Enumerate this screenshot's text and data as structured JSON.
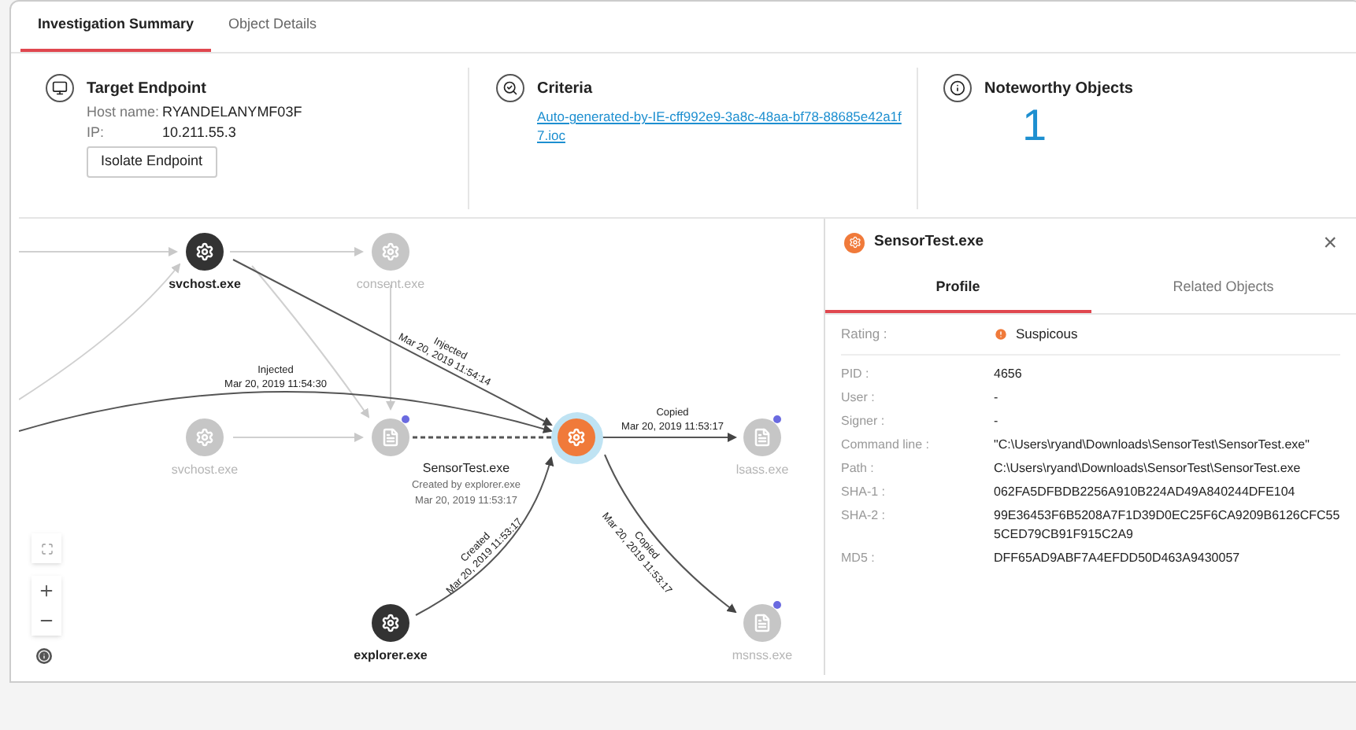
{
  "tabs": [
    {
      "label": "Investigation Summary",
      "selected": true
    },
    {
      "label": "Object Details",
      "selected": false
    }
  ],
  "target": {
    "title": "Target Endpoint",
    "fields": [
      {
        "label": "Host name:",
        "value": "RYANDELANYMF03F"
      },
      {
        "label": "IP:",
        "value": "10.211.55.3"
      }
    ],
    "button": "Isolate Endpoint"
  },
  "criteria": {
    "title": "Criteria",
    "link": "Auto-generated-by-IE-cff992e9-3a8c-48aa-bf78-88685e42a1f7.ioc"
  },
  "noteworthy": {
    "title": "Noteworthy Objects",
    "count": "1"
  },
  "graph": {
    "nodes": [
      {
        "label": "svchost.exe",
        "kind": "process",
        "selected": false,
        "dimmed": false,
        "flagged": false
      },
      {
        "label": "consent.exe",
        "kind": "process",
        "selected": false,
        "dimmed": true,
        "flagged": false
      },
      {
        "label": "svchost.exe",
        "kind": "process",
        "selected": false,
        "dimmed": true,
        "flagged": false
      },
      {
        "kind": "file",
        "selected": false,
        "dimmed": true,
        "flagged": true
      },
      {
        "kind": "process",
        "selected": true,
        "dimmed": false,
        "flagged": false
      },
      {
        "label": "lsass.exe",
        "kind": "file",
        "selected": false,
        "dimmed": true,
        "flagged": true
      },
      {
        "label": "explorer.exe",
        "kind": "process",
        "selected": false,
        "dimmed": false,
        "flagged": false
      },
      {
        "label": "msnss.exe",
        "kind": "file",
        "selected": false,
        "dimmed": true,
        "flagged": true
      }
    ],
    "edges": [
      {
        "action": "Injected",
        "time": "Mar 20, 2019 11:54:14"
      },
      {
        "action": "Injected",
        "time": "Mar 20, 2019 11:54:30"
      },
      {
        "action": "Copied",
        "time": "Mar 20, 2019 11:53:17"
      },
      {
        "action": "Copied",
        "time": "Mar 20, 2019 11:53:17"
      },
      {
        "action": "Created",
        "time": "Mar 20, 2019 11:53:17"
      }
    ],
    "selected_caption": {
      "name": "SensorTest.exe",
      "created_by": "Created by explorer.exe",
      "time": "Mar 20, 2019 11:53:17"
    }
  },
  "panel": {
    "title": "SensorTest.exe",
    "close": "×",
    "tabs": [
      {
        "label": "Profile",
        "selected": true
      },
      {
        "label": "Related Objects",
        "selected": false
      }
    ],
    "rating": {
      "label": "Rating :",
      "value": "Suspicous"
    },
    "fields": [
      {
        "label": "PID :",
        "value": "4656"
      },
      {
        "label": "User :",
        "value": "-"
      },
      {
        "label": "Signer :",
        "value": "-"
      },
      {
        "label": "Command line :",
        "value": "\"C:\\Users\\ryand\\Downloads\\SensorTest\\SensorTest.exe\""
      },
      {
        "label": "Path :",
        "value": "C:\\Users\\ryand\\Downloads\\SensorTest\\SensorTest.exe"
      },
      {
        "label": "SHA-1 :",
        "value": "062FA5DFBDB2256A910B224AD49A840244DFE104"
      },
      {
        "label": "SHA-2 :",
        "value": "99E36453F6B5208A7F1D39D0EC25F6CA9209B6126CFC555CED79CB91F915C2A9"
      },
      {
        "label": "MD5 :",
        "value": "DFF65AD9ABF7A4EFDD50D463A9430057"
      }
    ]
  }
}
